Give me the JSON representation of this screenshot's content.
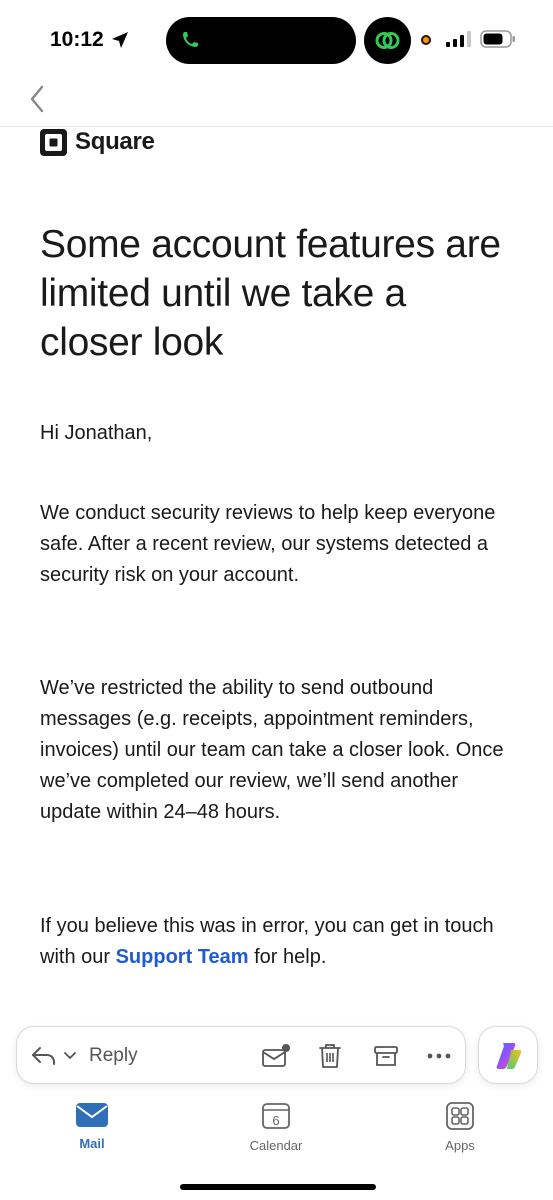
{
  "status_bar": {
    "time": "10:12",
    "icons": [
      "location-arrow-icon",
      "phone-call-icon",
      "linked-rings-icon",
      "recording-dot-icon",
      "cellular-signal-icon",
      "battery-icon"
    ]
  },
  "nav": {
    "back_icon": "chevron-left-icon"
  },
  "email": {
    "brand": "Square",
    "headline": "Some account features are limited until we take a closer look",
    "greeting": "Hi Jonathan,",
    "para1": "We conduct security reviews to help keep everyone safe. After a recent review, our systems detected a security risk on your account.",
    "para2": "We’ve restricted the ability to send outbound messages (e.g. receipts, appointment reminders, invoices) until our team can take a closer look. Once we’ve completed our review, we’ll send another update within 24–48 hours.",
    "para3_before": "If you believe this was in error, you can get in touch with our ",
    "para3_link": "Support Team",
    "para3_after": " for help."
  },
  "action_bar": {
    "reply_label": "Reply",
    "icons": [
      "reply-icon",
      "chevron-down-icon",
      "mark-unread-icon",
      "trash-icon",
      "archive-icon",
      "more-icon"
    ]
  },
  "tabs": [
    {
      "label": "Mail",
      "icon": "mail-icon",
      "active": true
    },
    {
      "label": "Calendar",
      "icon": "calendar-icon",
      "day": "6",
      "active": false
    },
    {
      "label": "Apps",
      "icon": "apps-grid-icon",
      "active": false
    }
  ],
  "colors": {
    "link": "#1f5bd1",
    "active_tab": "#2f6fb5",
    "call_green": "#34c759",
    "recording_orange": "#ff9500"
  }
}
